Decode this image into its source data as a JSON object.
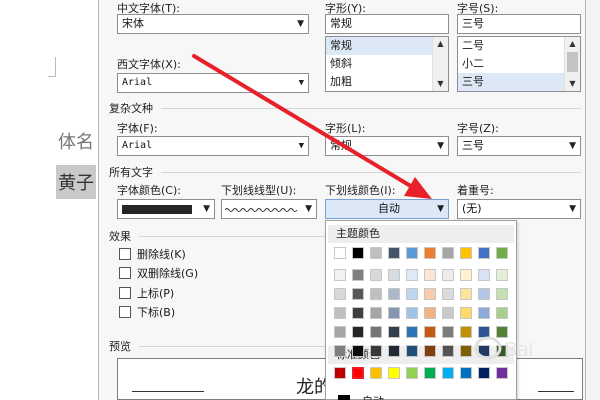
{
  "font_section": {
    "cn_font_label": "中文字体(T):",
    "cn_font_value": "宋体",
    "style_label": "字形(Y):",
    "style_value": "常规",
    "style_options": [
      "常规",
      "倾斜",
      "加粗"
    ],
    "size_label": "字号(S):",
    "size_value": "三号",
    "size_options": [
      "二号",
      "小二",
      "三号"
    ],
    "west_font_label": "西文字体(X):",
    "west_font_value": "Arial"
  },
  "complex_section": {
    "title": "复杂文种",
    "font_label": "字体(F):",
    "font_value": "Arial",
    "style_label": "字形(L):",
    "style_value": "常规",
    "size_label": "字号(Z):",
    "size_value": "三号"
  },
  "all_text_section": {
    "title": "所有文字",
    "font_color_label": "字体颜色(C):",
    "underline_type_label": "下划线线型(U):",
    "underline_color_label": "下划线颜色(I):",
    "underline_color_value": "自动",
    "emphasis_label": "着重号:",
    "emphasis_value": "(无)"
  },
  "effects_section": {
    "title": "效果",
    "checkboxes": [
      "删除线(K)",
      "双删除线(G)",
      "上标(P)",
      "下标(B)"
    ]
  },
  "preview_section": {
    "title": "预览",
    "sample_text": "龙的"
  },
  "color_popup": {
    "theme_title": "主题颜色",
    "theme_top": [
      "#ffffff",
      "#000000",
      "#bfbfbf",
      "#44546a",
      "#5b9bd5",
      "#ed7d31",
      "#a5a5a5",
      "#ffc000",
      "#4472c4",
      "#70ad47"
    ],
    "theme_grid": [
      [
        "#f2f2f2",
        "#7f7f7f",
        "#d9d9d9",
        "#d6dce4",
        "#deebf6",
        "#fbe5d5",
        "#ededed",
        "#fff2cc",
        "#dae3f3",
        "#e2efd9"
      ],
      [
        "#d9d9d9",
        "#595959",
        "#bfbfbf",
        "#adb9ca",
        "#bdd7ee",
        "#f7cbac",
        "#dbdbdb",
        "#fee599",
        "#b4c6e7",
        "#c5e0b3"
      ],
      [
        "#bfbfbf",
        "#3f3f3f",
        "#a6a6a6",
        "#8496b0",
        "#9dc3e6",
        "#f4b183",
        "#c9c9c9",
        "#ffd966",
        "#8eaadb",
        "#a8d08d"
      ],
      [
        "#a6a6a6",
        "#262626",
        "#757575",
        "#333f4f",
        "#2e75b5",
        "#c55a11",
        "#7b7b7b",
        "#bf9000",
        "#2f5496",
        "#538135"
      ],
      [
        "#7f7f7f",
        "#0c0c0c",
        "#3a3a3a",
        "#222a35",
        "#1e4e79",
        "#833c0b",
        "#525252",
        "#7f6000",
        "#1f3864",
        "#375623"
      ]
    ],
    "standard_title": "标准颜色",
    "standard": [
      "#c00000",
      "#ff0000",
      "#ffc000",
      "#ffff00",
      "#92d050",
      "#00b050",
      "#00b0f0",
      "#0070c0",
      "#002060",
      "#7030a0"
    ],
    "auto_label": "自动"
  },
  "background_doc": {
    "text1": "体名",
    "text2": "黄子"
  }
}
